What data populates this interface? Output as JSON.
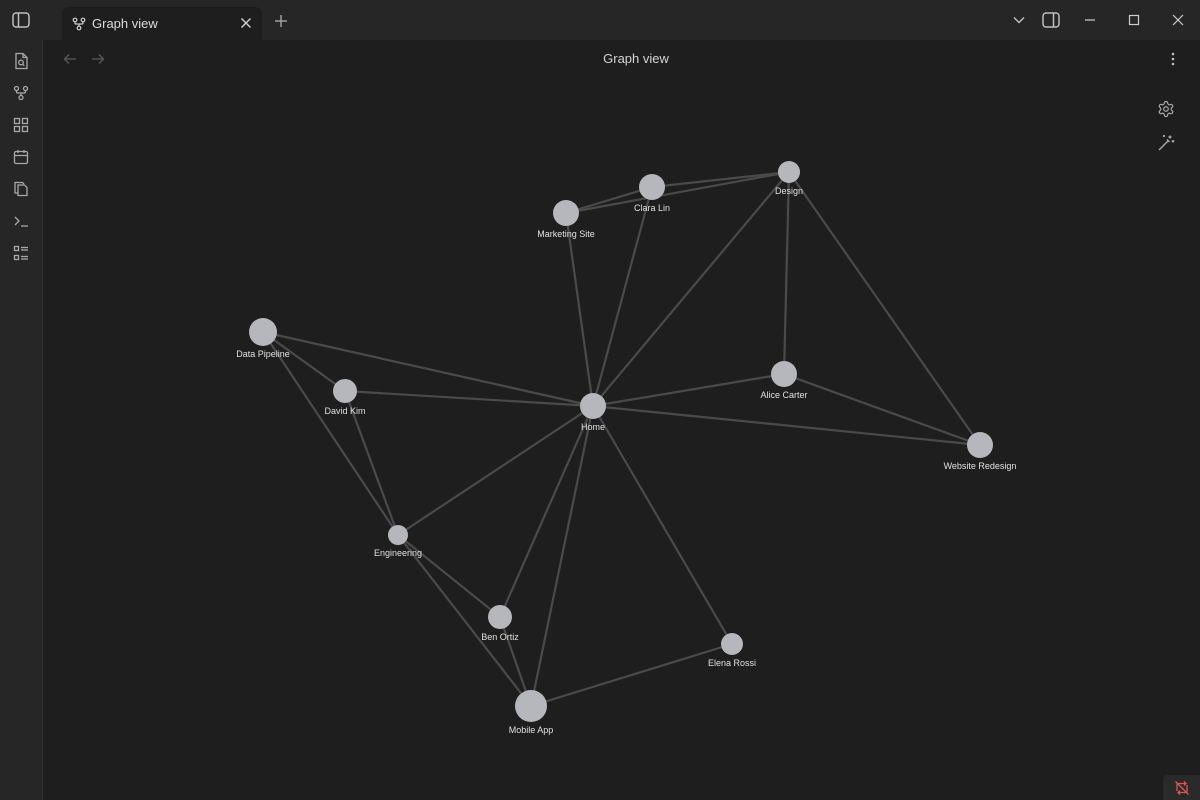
{
  "window": {
    "tab_title": "Graph view",
    "icons": {
      "sidebar_toggle": "sidebar-left-icon",
      "tab": "git-fork-icon",
      "tab_close": "close-icon",
      "new_tab": "plus-icon",
      "tab_list": "chevron-down-icon",
      "right_sidebar": "sidebar-right-icon",
      "minimize": "minimize-icon",
      "maximize": "maximize-icon",
      "close": "close-icon"
    }
  },
  "ribbon": {
    "items": [
      {
        "icon": "file-search-icon"
      },
      {
        "icon": "git-fork-icon"
      },
      {
        "icon": "layout-dashboard-icon"
      },
      {
        "icon": "calendar-icon"
      },
      {
        "icon": "copy-icon"
      },
      {
        "icon": "terminal-icon"
      },
      {
        "icon": "list-icon"
      }
    ]
  },
  "view": {
    "title": "Graph view",
    "icons": {
      "back": "arrow-left-icon",
      "forward": "arrow-right-icon",
      "more": "more-vertical-icon",
      "settings": "settings-icon",
      "animate": "wand-icon"
    }
  },
  "graph": {
    "colors": {
      "node": "#b6b6bd",
      "edge": "#4a4a4a",
      "label": "#e0e0e0"
    },
    "nodes": [
      {
        "id": "design",
        "label": "Design"
      },
      {
        "id": "clara",
        "label": "Clara Lin"
      },
      {
        "id": "marketing",
        "label": "Marketing Site"
      },
      {
        "id": "pipeline",
        "label": "Data Pipeline"
      },
      {
        "id": "david",
        "label": "David Kim"
      },
      {
        "id": "home",
        "label": "Home"
      },
      {
        "id": "alice",
        "label": "Alice Carter"
      },
      {
        "id": "website",
        "label": "Website Redesign"
      },
      {
        "id": "engineering",
        "label": "Engineering"
      },
      {
        "id": "ben",
        "label": "Ben Ortiz"
      },
      {
        "id": "elena",
        "label": "Elena Rossi"
      },
      {
        "id": "mobile",
        "label": "Mobile App"
      }
    ],
    "edges": [
      [
        "marketing",
        "clara"
      ],
      [
        "marketing",
        "design"
      ],
      [
        "clara",
        "design"
      ],
      [
        "marketing",
        "home"
      ],
      [
        "clara",
        "home"
      ],
      [
        "design",
        "home"
      ],
      [
        "design",
        "alice"
      ],
      [
        "design",
        "website"
      ],
      [
        "pipeline",
        "home"
      ],
      [
        "pipeline",
        "david"
      ],
      [
        "pipeline",
        "engineering"
      ],
      [
        "david",
        "home"
      ],
      [
        "david",
        "engineering"
      ],
      [
        "home",
        "alice"
      ],
      [
        "home",
        "website"
      ],
      [
        "alice",
        "website"
      ],
      [
        "home",
        "engineering"
      ],
      [
        "home",
        "ben"
      ],
      [
        "home",
        "mobile"
      ],
      [
        "home",
        "elena"
      ],
      [
        "engineering",
        "ben"
      ],
      [
        "engineering",
        "mobile"
      ],
      [
        "ben",
        "mobile"
      ],
      [
        "mobile",
        "elena"
      ]
    ]
  },
  "status": {
    "icon": "sync-off-icon",
    "color": "#e05555"
  }
}
